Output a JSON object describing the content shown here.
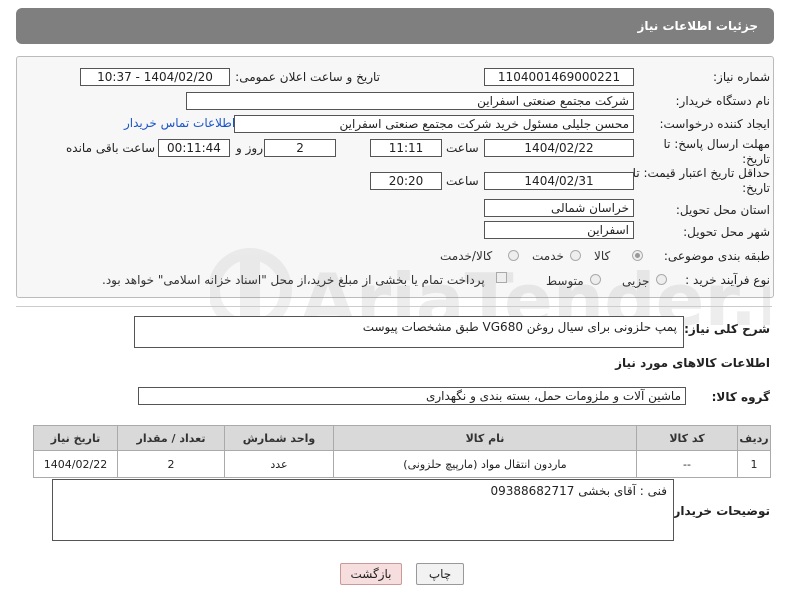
{
  "header": {
    "title": "جزئیات اطلاعات نیاز"
  },
  "need_number": {
    "label": "شماره نیاز:",
    "value": "1104001469000221"
  },
  "announce": {
    "label": "تاریخ و ساعت اعلان عمومی:",
    "value": "1404/02/20 - 10:37"
  },
  "buyer_org": {
    "label": "نام دستگاه خریدار:",
    "value": "شرکت مجتمع صنعتی اسفراین"
  },
  "requester": {
    "label": "ایجاد کننده درخواست:",
    "value": "محسن جلیلی مسئول خرید شرکت مجتمع صنعتی اسفراین",
    "contact_link": "اطلاعات تماس خریدار"
  },
  "deadline": {
    "label": "مهلت ارسال پاسخ: تا تاریخ:",
    "date": "1404/02/22",
    "time_label": "ساعت",
    "time": "11:11",
    "days": "2",
    "days_label": "روز و",
    "remaining": "00:11:44",
    "remaining_label": "ساعت باقی مانده"
  },
  "price_validity": {
    "label": "حداقل تاریخ اعتبار قیمت: تا تاریخ:",
    "date": "1404/02/31",
    "time_label": "ساعت",
    "time": "20:20"
  },
  "province": {
    "label": "استان محل تحویل:",
    "value": "خراسان شمالی"
  },
  "city": {
    "label": "شهر محل تحویل:",
    "value": "اسفراین"
  },
  "category": {
    "label": "طبقه بندی موضوعی:",
    "options": [
      "کالا",
      "خدمت",
      "کالا/خدمت"
    ],
    "selected": "کالا"
  },
  "process": {
    "label": "نوع فرآیند خرید :",
    "options": [
      "جزیی",
      "متوسط"
    ],
    "payment_note": "پرداخت تمام یا بخشی از مبلغ خرید،از محل \"اسناد خزانه اسلامی\" خواهد بود."
  },
  "description": {
    "label": "شرح کلی نیاز:",
    "value": "پمپ حلزونی برای سیال روغن VG680 طبق مشخصات پیوست"
  },
  "goods_info": {
    "title": "اطلاعات کالاهای مورد نیاز"
  },
  "goods_group": {
    "label": "گروه کالا:",
    "value": "ماشین آلات و ملزومات حمل، بسته بندی و نگهداری"
  },
  "table": {
    "headers": [
      "ردیف",
      "کد کالا",
      "نام کالا",
      "واحد شمارش",
      "تعداد / مقدار",
      "تاریخ نیاز"
    ],
    "rows": [
      [
        "1",
        "--",
        "ماردون انتقال مواد (مارپیچ حلزونی)",
        "عدد",
        "2",
        "1404/02/22"
      ]
    ]
  },
  "buyer_notes": {
    "label": "توضیحات خریدار:",
    "value": "فنی : آقای بخشی 09388682717"
  },
  "buttons": {
    "print": "چاپ",
    "back": "بازگشت"
  },
  "watermark": {
    "text": "AriaTender.neT"
  }
}
